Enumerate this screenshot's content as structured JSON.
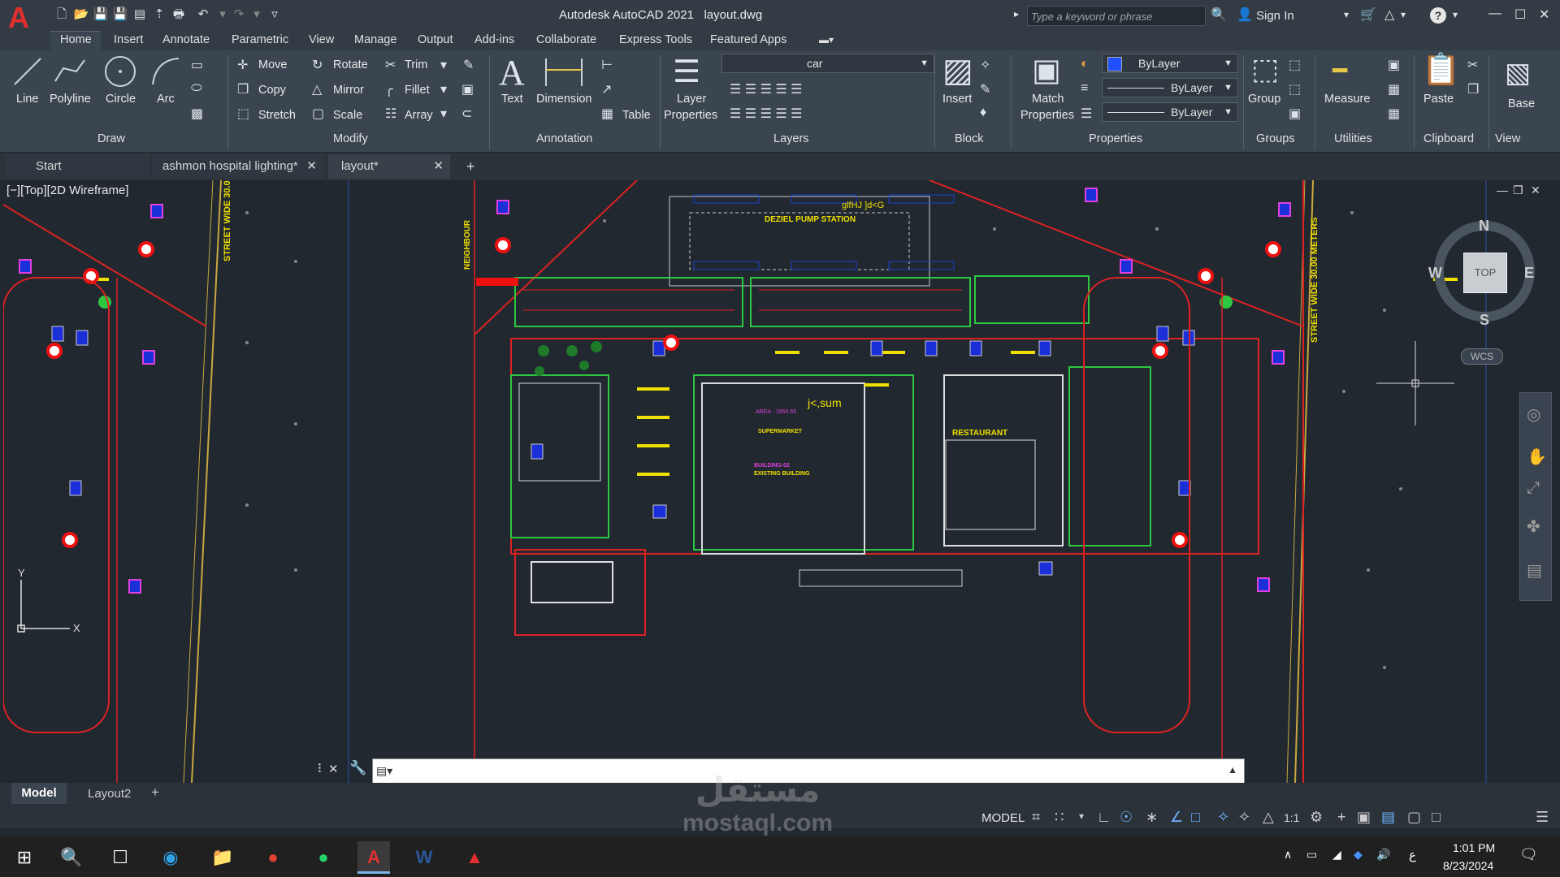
{
  "titlebar": {
    "app_title": "Autodesk AutoCAD 2021",
    "file_name": "layout.dwg",
    "search_placeholder": "Type a keyword or phrase",
    "sign_in": "Sign In"
  },
  "menu_tabs": [
    "Home",
    "Insert",
    "Annotate",
    "Parametric",
    "View",
    "Manage",
    "Output",
    "Add-ins",
    "Collaborate",
    "Express Tools",
    "Featured Apps"
  ],
  "ribbon": {
    "draw": {
      "title": "Draw",
      "line": "Line",
      "polyline": "Polyline",
      "circle": "Circle",
      "arc": "Arc"
    },
    "modify": {
      "title": "Modify",
      "move": "Move",
      "rotate": "Rotate",
      "trim": "Trim",
      "copy": "Copy",
      "mirror": "Mirror",
      "fillet": "Fillet",
      "stretch": "Stretch",
      "scale": "Scale",
      "array": "Array"
    },
    "annotation": {
      "title": "Annotation",
      "text": "Text",
      "dimension": "Dimension",
      "table": "Table"
    },
    "layers": {
      "title": "Layers",
      "layer_properties_1": "Layer",
      "layer_properties_2": "Properties",
      "current_layer": "car"
    },
    "block": {
      "title": "Block",
      "insert": "Insert"
    },
    "properties": {
      "title": "Properties",
      "match_1": "Match",
      "match_2": "Properties",
      "color": "ByLayer",
      "linetype": "ByLayer",
      "lineweight": "ByLayer"
    },
    "groups": {
      "title": "Groups",
      "group": "Group"
    },
    "utilities": {
      "title": "Utilities",
      "measure": "Measure"
    },
    "clipboard": {
      "title": "Clipboard",
      "paste": "Paste"
    },
    "view": {
      "title": "View",
      "base": "Base"
    }
  },
  "doc_tabs": [
    {
      "label": "Start"
    },
    {
      "label": "ashmon hospital lighting*"
    },
    {
      "label": "layout*"
    }
  ],
  "viewport": {
    "label": "[−][Top][2D Wireframe]",
    "viewcube": {
      "top": "TOP",
      "n": "N",
      "s": "S",
      "e": "E",
      "w": "W",
      "wcs": "WCS"
    }
  },
  "drawing_text": {
    "pump_station": "DEZIEL PUMP STATION",
    "street_1": "STREET WIDE 30.00 METERS",
    "neighbour": "NEIGHBOUR",
    "supermarket": "SUPERMARKET",
    "restaurant": "RESTAURANT",
    "building": "BUILDING-02",
    "existing": "EXISTING BUILDING",
    "area": "AREA - 1955.55",
    "arabic_1": "j<,sum",
    "arabic_2": "glfHJ ]d<G"
  },
  "layout_tabs": [
    "Model",
    "Layout2"
  ],
  "statusbar": {
    "model": "MODEL",
    "scale": "1:1"
  },
  "taskbar": {
    "time": "1:01 PM",
    "date": "8/23/2024",
    "lang": "ع"
  },
  "watermark": {
    "ar": "مستقل",
    "en": "mostaql.com"
  },
  "colors": {
    "accent": "#e12f2f",
    "ribbon": "#3b4550",
    "canvas": "#212830"
  }
}
